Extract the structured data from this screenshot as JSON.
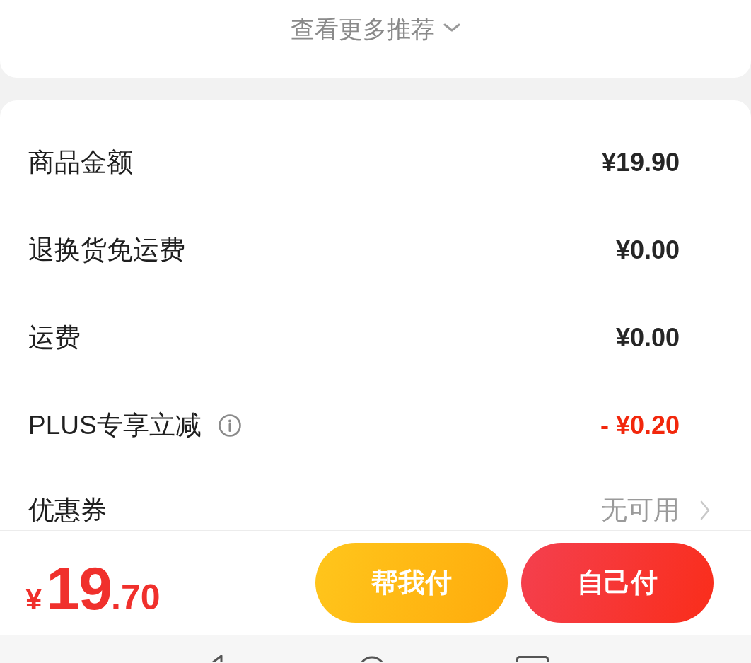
{
  "more_recommendations": {
    "label": "查看更多推荐"
  },
  "summary_rows": [
    {
      "kind": "amount",
      "label": "商品金额",
      "value": "¥19.90"
    },
    {
      "kind": "amount",
      "label": "退换货免运费",
      "value": "¥0.00"
    },
    {
      "kind": "amount",
      "label": "运费",
      "value": "¥0.00"
    },
    {
      "kind": "discount",
      "label": "PLUS专享立减",
      "info": true,
      "value": "- ¥0.20"
    },
    {
      "kind": "link",
      "label": "优惠券",
      "value": "无可用"
    }
  ],
  "bottom_bar": {
    "total": {
      "currency": "¥",
      "integer": "19",
      "fraction": ".70"
    },
    "buttons": [
      {
        "kind": "secondary",
        "label": "帮我付"
      },
      {
        "kind": "primary",
        "label": "自己付"
      }
    ]
  }
}
